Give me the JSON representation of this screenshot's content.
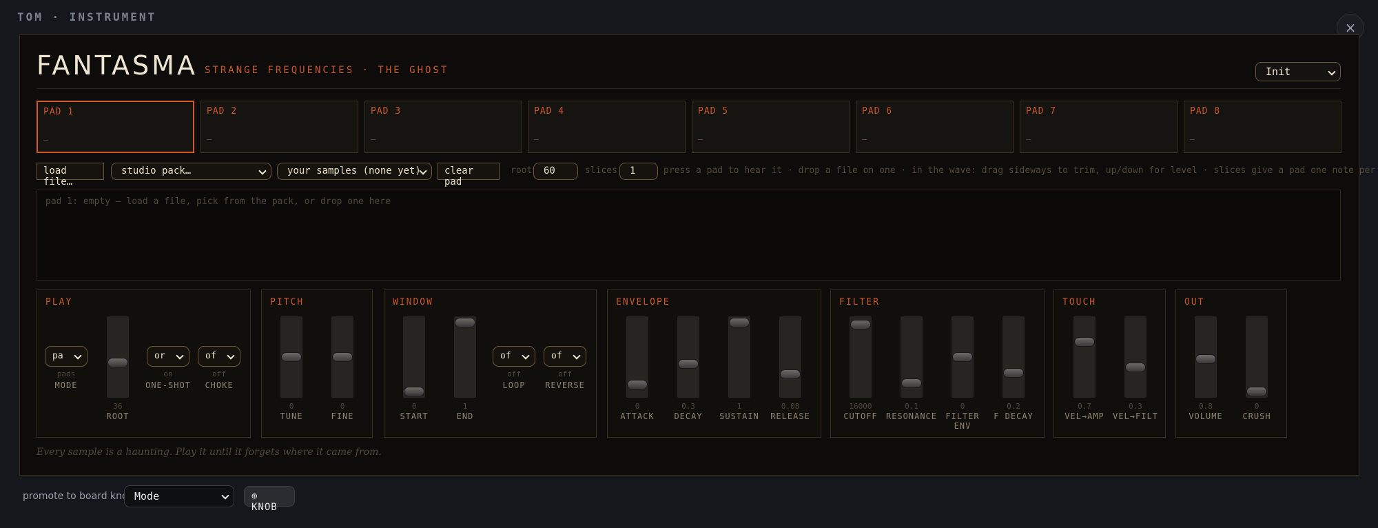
{
  "window": {
    "title": "TOM · INSTRUMENT",
    "close": "×"
  },
  "header": {
    "brand": "FANTASMA",
    "tagline": "STRANGE FREQUENCIES · THE GHOST",
    "preset": "Init"
  },
  "pads": [
    {
      "label": "PAD 1",
      "value": "–"
    },
    {
      "label": "PAD 2",
      "value": "–"
    },
    {
      "label": "PAD 3",
      "value": "–"
    },
    {
      "label": "PAD 4",
      "value": "–"
    },
    {
      "label": "PAD 5",
      "value": "–"
    },
    {
      "label": "PAD 6",
      "value": "–"
    },
    {
      "label": "PAD 7",
      "value": "–"
    },
    {
      "label": "PAD 8",
      "value": "–"
    }
  ],
  "controls": {
    "load": "load file…",
    "pack": "studio pack…",
    "samples": "your samples (none yet)",
    "clear": "clear pad",
    "root_label": "root",
    "root_value": "60",
    "slices_label": "slices",
    "slices_value": "1",
    "hint": "press a pad to hear it · drop a file on one · in the wave: drag sideways to trim, up/down for level · slices give a pad one note per piece"
  },
  "wave": {
    "text": "pad 1: empty — load a file, pick from the pack, or drop one here"
  },
  "groups": {
    "play": {
      "title": "PLAY",
      "mode": {
        "value": "pa",
        "sub": "pads",
        "label": "MODE"
      },
      "root": {
        "value": "36",
        "label": "ROOT",
        "level": 0.42
      },
      "oneshot": {
        "value": "or",
        "sub": "on",
        "label": "ONE-SHOT"
      },
      "choke": {
        "value": "of",
        "sub": "off",
        "label": "CHOKE"
      }
    },
    "pitch": {
      "title": "PITCH",
      "tune": {
        "value": "0",
        "label": "TUNE",
        "level": 0.5
      },
      "fine": {
        "value": "0",
        "label": "FINE",
        "level": 0.5
      }
    },
    "window": {
      "title": "WINDOW",
      "start": {
        "value": "0",
        "label": "START",
        "level": 0.0
      },
      "end": {
        "value": "1",
        "label": "END",
        "level": 1.0
      },
      "loop": {
        "value": "of",
        "sub": "off",
        "label": "LOOP"
      },
      "reverse": {
        "value": "of",
        "sub": "off",
        "label": "REVERSE"
      }
    },
    "envelope": {
      "title": "ENVELOPE",
      "attack": {
        "value": "0",
        "label": "ATTACK",
        "level": 0.1
      },
      "decay": {
        "value": "0.3",
        "label": "DECAY",
        "level": 0.4
      },
      "sustain": {
        "value": "1",
        "label": "SUSTAIN",
        "level": 1.0
      },
      "release": {
        "value": "0.08",
        "label": "RELEASE",
        "level": 0.25
      }
    },
    "filter": {
      "title": "FILTER",
      "cutoff": {
        "value": "16000",
        "label": "CUTOFF",
        "level": 0.97
      },
      "resonance": {
        "value": "0.1",
        "label": "RESONANCE",
        "level": 0.12
      },
      "env": {
        "value": "0",
        "label": "FILTER ENV",
        "level": 0.5
      },
      "fdecay": {
        "value": "0.2",
        "label": "F DECAY",
        "level": 0.27
      }
    },
    "touch": {
      "title": "TOUCH",
      "velamp": {
        "value": "0.7",
        "label": "VEL→AMP",
        "level": 0.72
      },
      "velfilt": {
        "value": "0.3",
        "label": "VEL→FILT",
        "level": 0.35
      }
    },
    "out": {
      "title": "OUT",
      "volume": {
        "value": "0.8",
        "label": "VOLUME",
        "level": 0.47
      },
      "crush": {
        "value": "0",
        "label": "CRUSH",
        "level": 0.0
      }
    }
  },
  "footnote": "Every sample is a haunting. Play it until it forgets where it came from.",
  "footer": {
    "promote_label": "promote to board knob:",
    "promote_value": "Mode",
    "knob": "⊕ KNOB"
  }
}
